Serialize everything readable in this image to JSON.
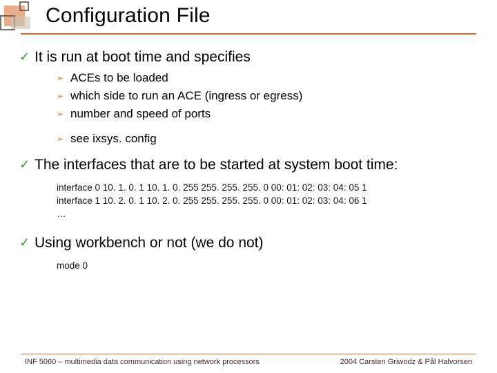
{
  "title": "Configuration File",
  "bullets": {
    "b1": {
      "text": "It is run at boot time and specifies"
    },
    "b1sub": {
      "s1": "ACEs to be loaded",
      "s2": "which side to run an ACE (ingress or egress)",
      "s3": "number and speed of ports",
      "s4": "see ixsys. config"
    },
    "b2": {
      "text": "The interfaces that are to be started at system boot time:"
    },
    "b2code": "interface 0 10. 1. 0. 1 10. 1. 0. 255 255. 255. 255. 0 00: 01: 02: 03: 04: 05 1\ninterface 1 10. 2. 0. 1 10. 2. 0. 255 255. 255. 255. 0 00: 01: 02: 03: 04: 06 1\n…",
    "b3": {
      "text": "Using workbench or not (we do not)"
    },
    "b3code": "mode 0"
  },
  "footer": {
    "left": "INF 5060 – multimedia data communication using network processors",
    "right": "2004  Carsten Griwodz & Pål Halvorsen"
  },
  "colors": {
    "accent": "#d96b29",
    "check": "#2f9f2f"
  }
}
